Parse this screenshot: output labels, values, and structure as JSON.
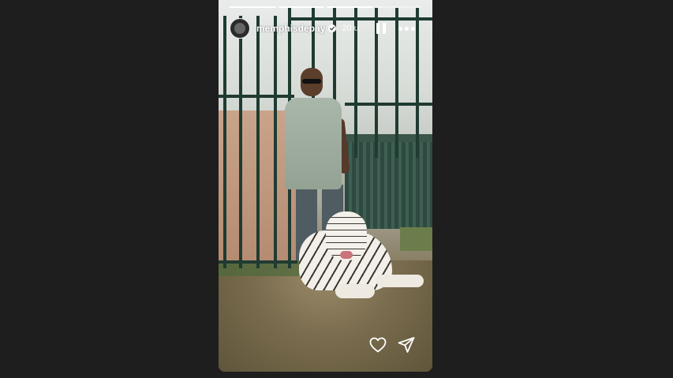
{
  "story": {
    "username": "memphisdepay",
    "verified": true,
    "time_ago": "20 u",
    "progress_segments": 4,
    "progress_completed": 3,
    "icons": {
      "avatar": "profile-avatar",
      "verified": "verified-badge-icon",
      "pause": "pause-icon",
      "more": "more-options-icon",
      "like": "heart-icon",
      "share": "send-icon"
    }
  },
  "colors": {
    "page_background": "#1e1e1e",
    "overlay_text": "#ffffff"
  }
}
